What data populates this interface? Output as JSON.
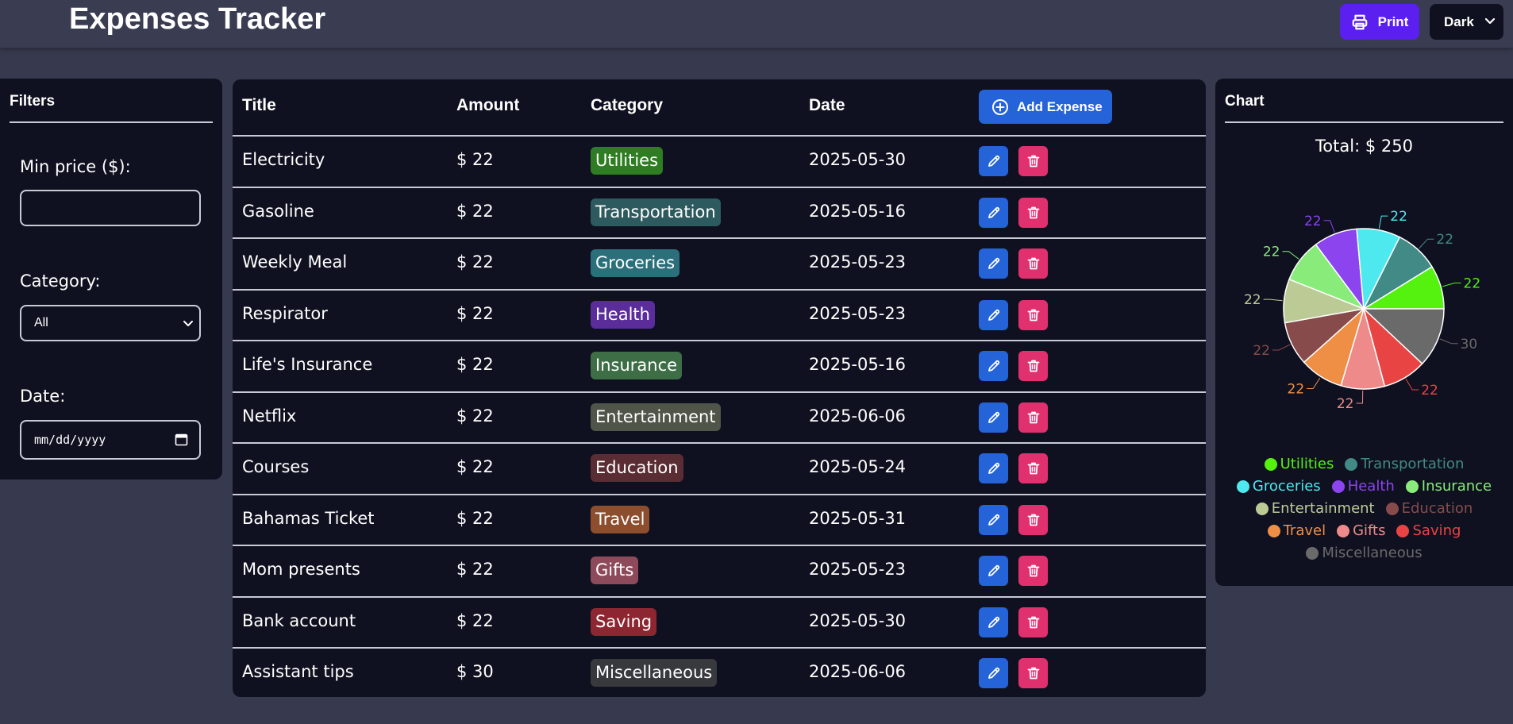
{
  "app": {
    "title": "Expenses Tracker"
  },
  "toolbar": {
    "print_label": "Print",
    "theme_value": "Dark",
    "icons": {
      "print": "printer-icon",
      "theme": "chevron-down-icon"
    }
  },
  "filters": {
    "title": "Filters",
    "min_price_label": "Min price ($):",
    "min_price_value": "",
    "category_label": "Category:",
    "category_value": "All",
    "date_label": "Date:",
    "date_placeholder": "mm/dd/yyyy"
  },
  "table": {
    "headers": {
      "title": "Title",
      "amount": "Amount",
      "category": "Category",
      "date": "Date"
    },
    "add_label": "Add Expense",
    "rows": [
      {
        "title": "Electricity",
        "amount": "$ 22",
        "category": "Utilities",
        "date": "2025-05-30",
        "badge_color": "#2f7d22"
      },
      {
        "title": "Gasoline",
        "amount": "$ 22",
        "category": "Transportation",
        "date": "2025-05-16",
        "badge_color": "#2d5a5e"
      },
      {
        "title": "Weekly Meal",
        "amount": "$ 22",
        "category": "Groceries",
        "date": "2025-05-23",
        "badge_color": "#2b6f7b"
      },
      {
        "title": "Respirator",
        "amount": "$ 22",
        "category": "Health",
        "date": "2025-05-23",
        "badge_color": "#5a2d9a"
      },
      {
        "title": "Life's Insurance",
        "amount": "$ 22",
        "category": "Insurance",
        "date": "2025-05-16",
        "badge_color": "#3d6e45"
      },
      {
        "title": "Netflix",
        "amount": "$ 22",
        "category": "Entertainment",
        "date": "2025-06-06",
        "badge_color": "#4f5549"
      },
      {
        "title": "Courses",
        "amount": "$ 22",
        "category": "Education",
        "date": "2025-05-24",
        "badge_color": "#5a2c33"
      },
      {
        "title": "Bahamas Ticket",
        "amount": "$ 22",
        "category": "Travel",
        "date": "2025-05-31",
        "badge_color": "#8d4e2e"
      },
      {
        "title": "Mom presents",
        "amount": "$ 22",
        "category": "Gifts",
        "date": "2025-05-23",
        "badge_color": "#8d4a5a"
      },
      {
        "title": "Bank account",
        "amount": "$ 22",
        "category": "Saving",
        "date": "2025-05-30",
        "badge_color": "#8c2630"
      },
      {
        "title": "Assistant tips",
        "amount": "$ 30",
        "category": "Miscellaneous",
        "date": "2025-06-06",
        "badge_color": "#38393d"
      }
    ]
  },
  "chart_panel": {
    "title": "Chart",
    "total_label": "Total: $ 250"
  },
  "chart_data": {
    "type": "pie",
    "categories": [
      "Utilities",
      "Transportation",
      "Groceries",
      "Health",
      "Insurance",
      "Entertainment",
      "Education",
      "Travel",
      "Gifts",
      "Saving",
      "Miscellaneous"
    ],
    "values": [
      22,
      22,
      22,
      22,
      22,
      22,
      22,
      22,
      22,
      22,
      30
    ],
    "colors": [
      "#54f20e",
      "#418a86",
      "#4ee9ee",
      "#8c44ee",
      "#89ec7a",
      "#bccb96",
      "#874b4b",
      "#ef8f46",
      "#ee8a8a",
      "#e84444",
      "#6a6a6a"
    ],
    "slice_order": [
      "Utilities",
      "Miscellaneous",
      "Saving",
      "Gifts",
      "Travel",
      "Education",
      "Entertainment",
      "Insurance",
      "Health",
      "Groceries",
      "Transportation"
    ],
    "legend": "bottom"
  }
}
